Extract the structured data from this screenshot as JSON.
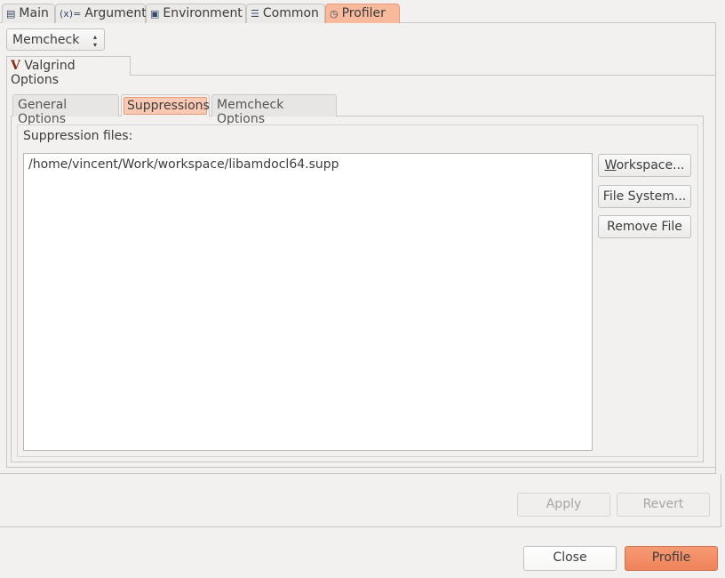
{
  "tabs": [
    {
      "label": "Main",
      "icon": "document-icon"
    },
    {
      "label": "Arguments",
      "icon": "variable-icon"
    },
    {
      "label": "Environment",
      "icon": "environment-icon"
    },
    {
      "label": "Common",
      "icon": "table-icon"
    },
    {
      "label": "Profiler",
      "icon": "clock-icon",
      "active": true
    }
  ],
  "tool_select": {
    "value": "Memcheck"
  },
  "options_tab": {
    "label": "Valgrind Options"
  },
  "subtabs": [
    {
      "label": "General Options"
    },
    {
      "label": "Suppressions",
      "active": true
    },
    {
      "label": "Memcheck Options"
    }
  ],
  "suppressions": {
    "label": "Suppression files:",
    "files": [
      "/home/vincent/Work/workspace/libamdocl64.supp"
    ],
    "workspace_button": "Workspace...",
    "filesystem_button": "File System...",
    "remove_button": "Remove File"
  },
  "actions": {
    "apply": "Apply",
    "revert": "Revert",
    "close": "Close",
    "profile": "Profile"
  },
  "colors": {
    "accent": "#f0835a"
  }
}
